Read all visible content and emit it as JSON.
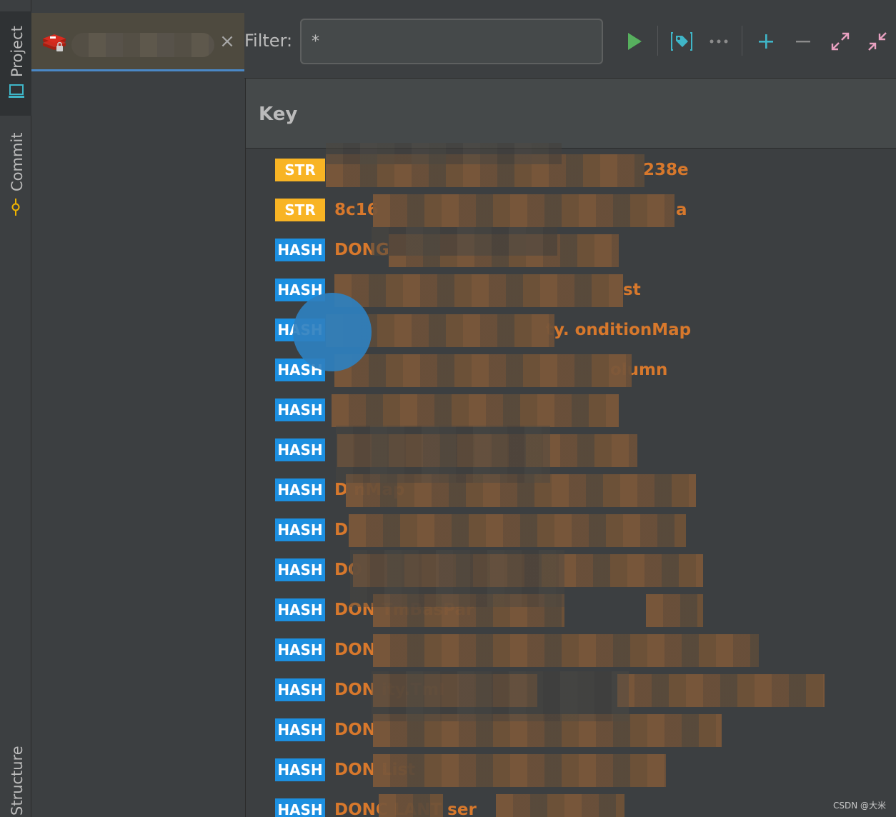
{
  "sidebar": {
    "project_label": "Project",
    "commit_label": "Commit",
    "structure_label": "Structure"
  },
  "connection_tab": {
    "close_label": "×"
  },
  "toolbar": {
    "filter_label": "Filter:",
    "filter_value": "*",
    "icons": [
      "run-icon",
      "tag-icon",
      "more-icon",
      "add-icon",
      "remove-icon",
      "expand-icon",
      "collapse-icon"
    ]
  },
  "table": {
    "column_key": "Key",
    "rows": [
      {
        "type": "STR",
        "text": "238e"
      },
      {
        "type": "STR",
        "text": "8c16"
      },
      {
        "type": "HASH",
        "text": "DONG"
      },
      {
        "type": "HASH",
        "text": "st"
      },
      {
        "type": "HASH",
        "text": "ty.      onditionMap"
      },
      {
        "type": "HASH",
        "text": "olumn"
      },
      {
        "type": "HASH",
        "text": ""
      },
      {
        "type": "HASH",
        "text": ""
      },
      {
        "type": "HASH",
        "text": "D                                 nMap"
      },
      {
        "type": "HASH",
        "text": "D"
      },
      {
        "type": "HASH",
        "text": "DO"
      },
      {
        "type": "HASH",
        "text": "DON                    TmBasPar"
      },
      {
        "type": "HASH",
        "text": "DON"
      },
      {
        "type": "HASH",
        "text": "DON              ity.TmI"
      },
      {
        "type": "HASH",
        "text": "DON"
      },
      {
        "type": "HASH",
        "text": "DON                          List"
      },
      {
        "type": "HASH",
        "text": "DONC      LANT              ser"
      }
    ]
  },
  "colors": {
    "str_badge": "#f8b424",
    "hash_badge": "#1c8fe0",
    "key_text": "#d7782c"
  },
  "watermark": "CSDN @大米"
}
